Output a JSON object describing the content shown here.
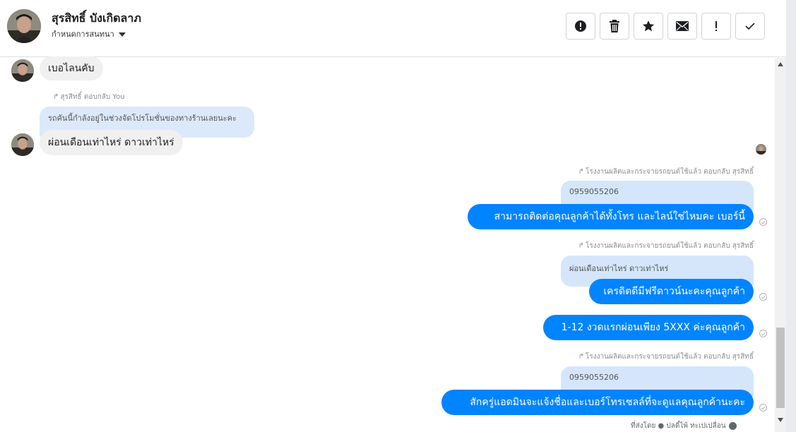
{
  "header": {
    "contact_name": "สุรสิทธิ์ บังเกิดลาภ",
    "subtitle": "กำหนดการสนทนา",
    "avatar_icon": "user-photo-icon"
  },
  "toolbar": {
    "buttons": [
      {
        "name": "report-spam-button",
        "icon": "alert-circle-icon"
      },
      {
        "name": "delete-button",
        "icon": "trash-icon"
      },
      {
        "name": "star-button",
        "icon": "star-icon"
      },
      {
        "name": "mark-unread-button",
        "icon": "envelope-icon"
      },
      {
        "name": "follow-up-button",
        "icon": "exclamation-icon"
      },
      {
        "name": "mark-done-button",
        "icon": "check-icon"
      }
    ]
  },
  "messages": {
    "m1": {
      "text": "เบอไลนคับ"
    },
    "reply1": {
      "label": "สุรสิทธิ์ ตอบกลับ You",
      "quoted": "รถคันนี้กำลังอยู่ในช่วงจัดโปรโมชั่นของทางร้านเลยนะคะ"
    },
    "m2": {
      "text": "ผ่อนเดือนเท่าไหร่ ดาวเท่าไหร่"
    },
    "reply2": {
      "label": "โรงงานผลิตและกระจายรถยนต์ใช้แล้ว ตอบกลับ สุรสิทธิ์",
      "quoted": "0959055206"
    },
    "m3": {
      "text": "สามารถติดต่อคุณลูกค้าได้ทั้งโทร และไลน์ใช่ไหมคะ เบอร์นี้"
    },
    "reply3": {
      "label": "โรงงานผลิตและกระจายรถยนต์ใช้แล้ว ตอบกลับ สุรสิทธิ์",
      "quoted": "ผ่อนเดือนเท่าไหร่ ดาวเท่าไหร่"
    },
    "m4": {
      "text": "เครดิตดีมีฟรีดาวน์นะคะคุณลูกค้า"
    },
    "m5": {
      "text": "1-12 งวดแรกผ่อนเพียง 5XXX ค่ะคุณลูกค้า"
    },
    "reply4": {
      "label": "โรงงานผลิตและกระจายรถยนต์ใช้แล้ว ตอบกลับ สุรสิทธิ์",
      "quoted": "0959055206"
    },
    "m6": {
      "text": "สักครู่แอดมินจะแจ้งชื่อและเบอร์โทรเซลล์ที่จะดูแลคุณลูกค้านะคะ"
    },
    "footer": "ที่ส่งโดย ● ปลดิ์ไพ้ ทะเปเปลื่อน"
  },
  "colors": {
    "outgoing_bubble": "#0084ff",
    "incoming_bubble": "#f1f0f0",
    "quote_bubble": "#d5e6fb"
  }
}
